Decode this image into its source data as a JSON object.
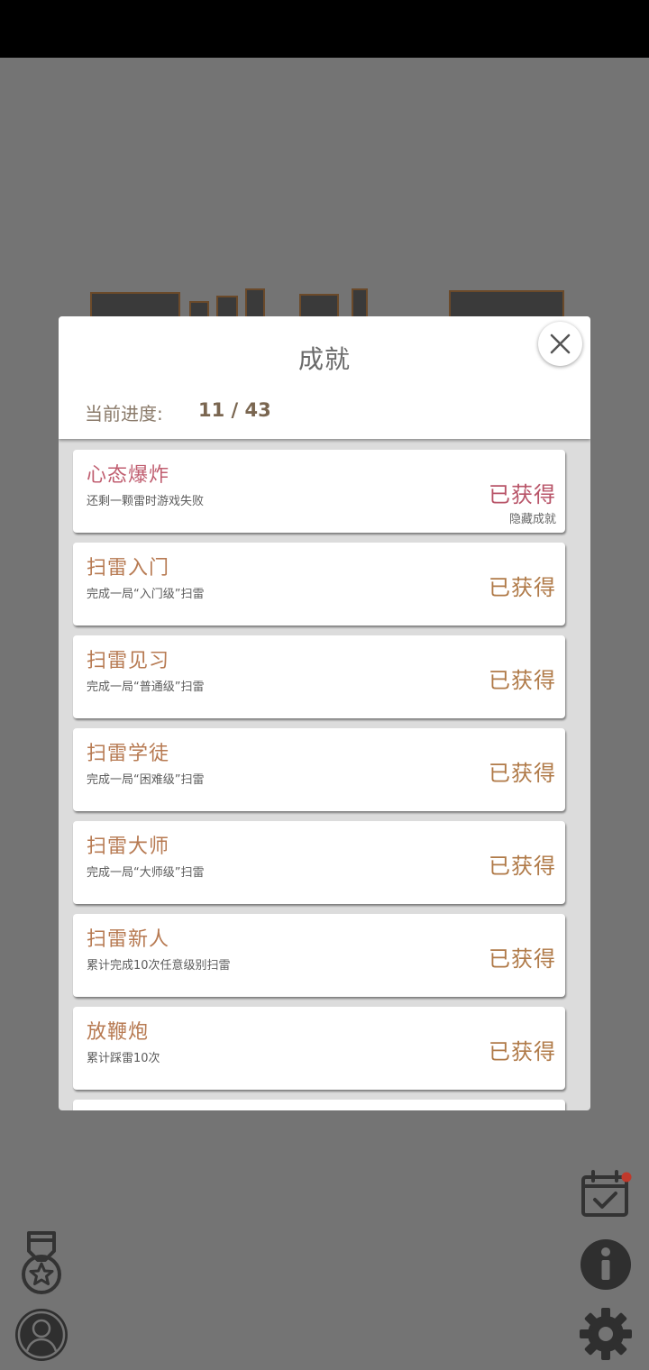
{
  "modal": {
    "title": "成就",
    "progress_label": "当前进度:",
    "progress_value": "11 / 43"
  },
  "achievements": [
    {
      "title": "心态爆炸",
      "desc": "还剩一颗雷时游戏失败",
      "status": "已获得",
      "tag": "隐藏成就"
    },
    {
      "title": "扫雷入门",
      "desc": "完成一局“入门级”扫雷",
      "status": "已获得",
      "tag": ""
    },
    {
      "title": "扫雷见习",
      "desc": "完成一局“普通级”扫雷",
      "status": "已获得",
      "tag": ""
    },
    {
      "title": "扫雷学徒",
      "desc": "完成一局“困难级”扫雷",
      "status": "已获得",
      "tag": ""
    },
    {
      "title": "扫雷大师",
      "desc": "完成一局“大师级”扫雷",
      "status": "已获得",
      "tag": ""
    },
    {
      "title": "扫雷新人",
      "desc": "累计完成10次任意级别扫雷",
      "status": "已获得",
      "tag": ""
    },
    {
      "title": "放鞭炮",
      "desc": "累计踩雷10次",
      "status": "已获得",
      "tag": ""
    }
  ],
  "icons": {
    "close": "close-icon",
    "medal": "medal-icon",
    "user": "user-icon",
    "calendar": "calendar-check-icon",
    "info": "info-icon",
    "settings": "gear-icon"
  },
  "colors": {
    "title_special": "#c05e70",
    "title_normal": "#b77a52",
    "notification_dot": "#c0392b"
  }
}
